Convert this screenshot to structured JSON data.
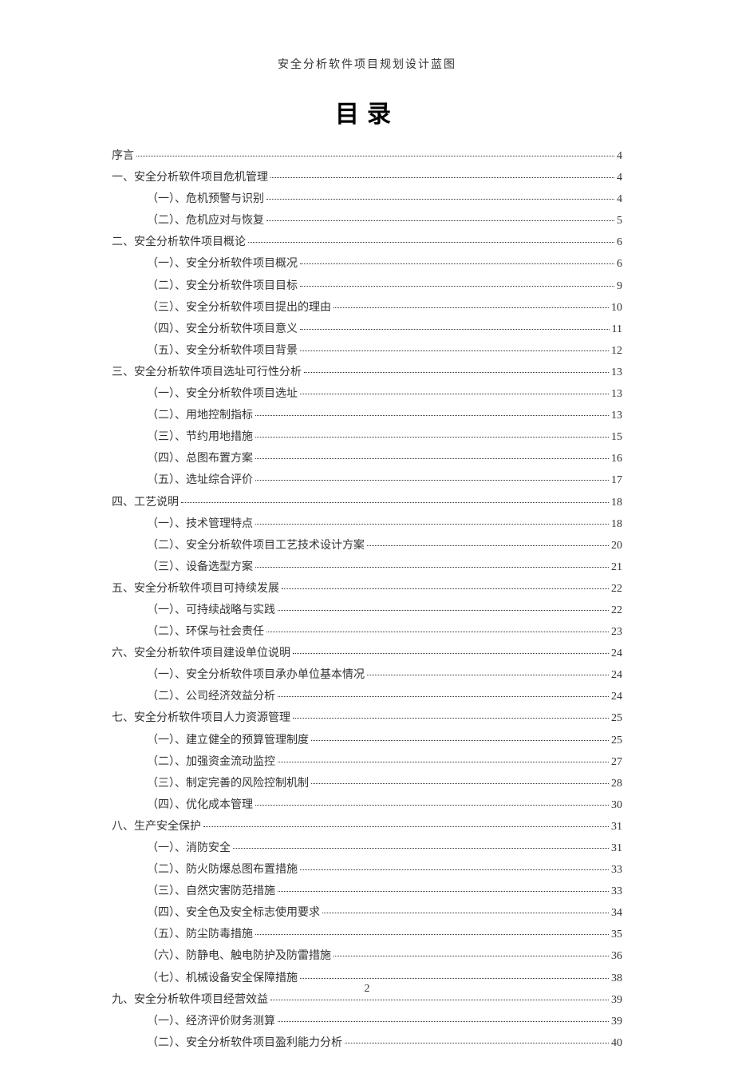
{
  "header": "安全分析软件项目规划设计蓝图",
  "title": "目录",
  "toc": [
    {
      "level": 0,
      "label": "序言",
      "page": "4"
    },
    {
      "level": 0,
      "label": "一、安全分析软件项目危机管理",
      "page": "4"
    },
    {
      "level": 1,
      "label": "（一）、危机预警与识别",
      "page": "4"
    },
    {
      "level": 1,
      "label": "（二）、危机应对与恢复",
      "page": "5"
    },
    {
      "level": 0,
      "label": "二、安全分析软件项目概论",
      "page": "6"
    },
    {
      "level": 1,
      "label": "（一）、安全分析软件项目概况",
      "page": "6"
    },
    {
      "level": 1,
      "label": "（二）、安全分析软件项目目标",
      "page": "9"
    },
    {
      "level": 1,
      "label": "（三）、安全分析软件项目提出的理由",
      "page": "10"
    },
    {
      "level": 1,
      "label": "（四）、安全分析软件项目意义",
      "page": "11"
    },
    {
      "level": 1,
      "label": "（五）、安全分析软件项目背景",
      "page": "12"
    },
    {
      "level": 0,
      "label": "三、安全分析软件项目选址可行性分析",
      "page": "13"
    },
    {
      "level": 1,
      "label": "（一）、安全分析软件项目选址",
      "page": "13"
    },
    {
      "level": 1,
      "label": "（二）、用地控制指标",
      "page": "13"
    },
    {
      "level": 1,
      "label": "（三）、节约用地措施",
      "page": "15"
    },
    {
      "level": 1,
      "label": "（四）、总图布置方案",
      "page": "16"
    },
    {
      "level": 1,
      "label": "（五）、选址综合评价",
      "page": "17"
    },
    {
      "level": 0,
      "label": "四、工艺说明",
      "page": "18"
    },
    {
      "level": 1,
      "label": "（一）、技术管理特点",
      "page": "18"
    },
    {
      "level": 1,
      "label": "（二）、安全分析软件项目工艺技术设计方案",
      "page": "20"
    },
    {
      "level": 1,
      "label": "（三）、设备选型方案",
      "page": "21"
    },
    {
      "level": 0,
      "label": "五、安全分析软件项目可持续发展",
      "page": "22"
    },
    {
      "level": 1,
      "label": "（一）、可持续战略与实践",
      "page": "22"
    },
    {
      "level": 1,
      "label": "（二）、环保与社会责任",
      "page": "23"
    },
    {
      "level": 0,
      "label": "六、安全分析软件项目建设单位说明",
      "page": "24"
    },
    {
      "level": 1,
      "label": "（一）、安全分析软件项目承办单位基本情况",
      "page": "24"
    },
    {
      "level": 1,
      "label": "（二）、公司经济效益分析",
      "page": "24"
    },
    {
      "level": 0,
      "label": "七、安全分析软件项目人力资源管理",
      "page": "25"
    },
    {
      "level": 1,
      "label": "（一）、建立健全的预算管理制度",
      "page": "25"
    },
    {
      "level": 1,
      "label": "（二）、加强资金流动监控",
      "page": "27"
    },
    {
      "level": 1,
      "label": "（三）、制定完善的风险控制机制",
      "page": "28"
    },
    {
      "level": 1,
      "label": "（四）、优化成本管理",
      "page": "30"
    },
    {
      "level": 0,
      "label": "八、生产安全保护",
      "page": "31"
    },
    {
      "level": 1,
      "label": "（一）、消防安全",
      "page": "31"
    },
    {
      "level": 1,
      "label": "（二）、防火防爆总图布置措施",
      "page": "33"
    },
    {
      "level": 1,
      "label": "（三）、自然灾害防范措施",
      "page": "33"
    },
    {
      "level": 1,
      "label": "（四）、安全色及安全标志使用要求",
      "page": "34"
    },
    {
      "level": 1,
      "label": "（五）、防尘防毒措施",
      "page": "35"
    },
    {
      "level": 1,
      "label": "（六）、防静电、触电防护及防雷措施",
      "page": "36"
    },
    {
      "level": 1,
      "label": "（七）、机械设备安全保障措施",
      "page": "38"
    },
    {
      "level": 0,
      "label": "九、安全分析软件项目经营效益",
      "page": "39"
    },
    {
      "level": 1,
      "label": "（一）、经济评价财务测算",
      "page": "39"
    },
    {
      "level": 1,
      "label": "（二）、安全分析软件项目盈利能力分析",
      "page": "40"
    }
  ],
  "page_number": "2"
}
